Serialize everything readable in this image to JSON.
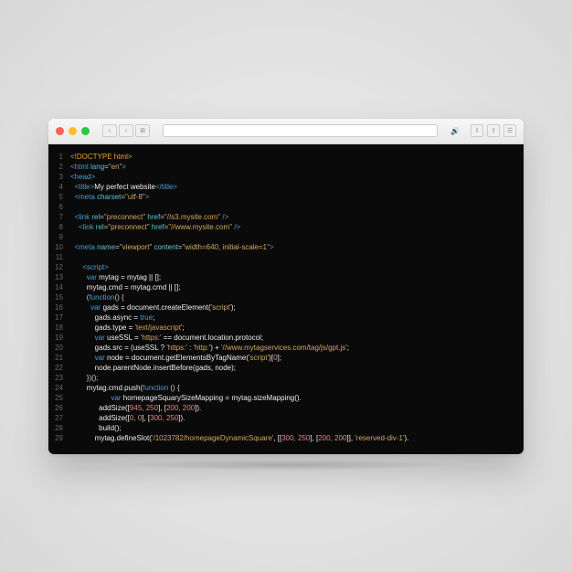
{
  "chrome": {
    "back": "‹",
    "fwd": "›",
    "tabs": "⊞",
    "sound": "🔊",
    "dl": "⇩",
    "share": "⇪",
    "menu": "☰"
  },
  "lines": [
    {
      "n": "1",
      "segs": [
        {
          "c": "code",
          "t": "<!DOCTYPE html>"
        }
      ],
      "ind": 0
    },
    {
      "n": "2",
      "segs": [
        {
          "c": "tag",
          "t": "<html "
        },
        {
          "c": "attr",
          "t": "lang"
        },
        {
          "c": "punc",
          "t": "="
        },
        {
          "c": "str",
          "t": "\"en\""
        },
        {
          "c": "tag",
          "t": ">"
        }
      ],
      "ind": 0
    },
    {
      "n": "3",
      "segs": [
        {
          "c": "tag",
          "t": "<head>"
        }
      ],
      "ind": 0
    },
    {
      "n": "4",
      "segs": [
        {
          "c": "tag",
          "t": "<title>"
        },
        {
          "c": "var",
          "t": "My perfect website"
        },
        {
          "c": "tag",
          "t": "</title>"
        }
      ],
      "ind": 2
    },
    {
      "n": "5",
      "segs": [
        {
          "c": "tag",
          "t": "<meta "
        },
        {
          "c": "attr",
          "t": "charset"
        },
        {
          "c": "punc",
          "t": "="
        },
        {
          "c": "str",
          "t": "\"utf-8\""
        },
        {
          "c": "tag",
          "t": ">"
        }
      ],
      "ind": 2
    },
    {
      "n": "6",
      "segs": [],
      "ind": 0
    },
    {
      "n": "7",
      "segs": [
        {
          "c": "tag",
          "t": "<link "
        },
        {
          "c": "attr",
          "t": "rel"
        },
        {
          "c": "punc",
          "t": "="
        },
        {
          "c": "str",
          "t": "\"preconnect\""
        },
        {
          "c": "attr",
          "t": " href"
        },
        {
          "c": "punc",
          "t": "="
        },
        {
          "c": "str",
          "t": "\"//s3.mysite.com\""
        },
        {
          "c": "tag",
          "t": " />"
        }
      ],
      "ind": 2
    },
    {
      "n": "8",
      "segs": [
        {
          "c": "tag",
          "t": "<link "
        },
        {
          "c": "attr",
          "t": "rel"
        },
        {
          "c": "punc",
          "t": "="
        },
        {
          "c": "str",
          "t": "\"preconnect\""
        },
        {
          "c": "attr",
          "t": " href"
        },
        {
          "c": "punc",
          "t": "="
        },
        {
          "c": "str",
          "t": "\"//www.mysite.com\""
        },
        {
          "c": "tag",
          "t": " />"
        }
      ],
      "ind": 4
    },
    {
      "n": "9",
      "segs": [],
      "ind": 0
    },
    {
      "n": "10",
      "segs": [
        {
          "c": "tag",
          "t": "<meta "
        },
        {
          "c": "attr",
          "t": "name"
        },
        {
          "c": "punc",
          "t": "="
        },
        {
          "c": "str",
          "t": "\"viewport\""
        },
        {
          "c": "attr",
          "t": " content"
        },
        {
          "c": "punc",
          "t": "="
        },
        {
          "c": "str",
          "t": "\"width=640, initial-scale=1\""
        },
        {
          "c": "tag",
          "t": ">"
        }
      ],
      "ind": 2
    },
    {
      "n": "11",
      "segs": [],
      "ind": 0
    },
    {
      "n": "12",
      "segs": [
        {
          "c": "tag",
          "t": "<script>"
        }
      ],
      "ind": 6
    },
    {
      "n": "13",
      "segs": [
        {
          "c": "kw",
          "t": "var "
        },
        {
          "c": "var",
          "t": "mytag = mytag || [];"
        }
      ],
      "ind": 8
    },
    {
      "n": "14",
      "segs": [
        {
          "c": "var",
          "t": "mytag.cmd = mytag.cmd || [];"
        }
      ],
      "ind": 8
    },
    {
      "n": "15",
      "segs": [
        {
          "c": "punc",
          "t": "("
        },
        {
          "c": "kw",
          "t": "function"
        },
        {
          "c": "punc",
          "t": "() {"
        }
      ],
      "ind": 8
    },
    {
      "n": "16",
      "segs": [
        {
          "c": "kw",
          "t": "var "
        },
        {
          "c": "var",
          "t": "gads = document.createElement("
        },
        {
          "c": "str",
          "t": "'script'"
        },
        {
          "c": "var",
          "t": ");"
        }
      ],
      "ind": 10
    },
    {
      "n": "17",
      "segs": [
        {
          "c": "var",
          "t": "gads.async = "
        },
        {
          "c": "kw",
          "t": "true"
        },
        {
          "c": "var",
          "t": ";"
        }
      ],
      "ind": 12
    },
    {
      "n": "18",
      "segs": [
        {
          "c": "var",
          "t": "gads.type = "
        },
        {
          "c": "str",
          "t": "'text/javascript'"
        },
        {
          "c": "var",
          "t": ";"
        }
      ],
      "ind": 12
    },
    {
      "n": "19",
      "segs": [
        {
          "c": "kw",
          "t": "var "
        },
        {
          "c": "var",
          "t": "useSSL = "
        },
        {
          "c": "str",
          "t": "'https:'"
        },
        {
          "c": "var",
          "t": " == document.location.protocol;"
        }
      ],
      "ind": 12
    },
    {
      "n": "20",
      "segs": [
        {
          "c": "var",
          "t": "gads.src = (useSSL ? "
        },
        {
          "c": "str",
          "t": "'https:'"
        },
        {
          "c": "var",
          "t": " : "
        },
        {
          "c": "str",
          "t": "'http:'"
        },
        {
          "c": "var",
          "t": ") + "
        },
        {
          "c": "str",
          "t": "'//www.mytagservices.com/tag/js/gpt.js'"
        },
        {
          "c": "var",
          "t": ";"
        }
      ],
      "ind": 12
    },
    {
      "n": "21",
      "segs": [
        {
          "c": "kw",
          "t": "var "
        },
        {
          "c": "var",
          "t": "node = document.getElementsByTagName("
        },
        {
          "c": "str",
          "t": "'script'"
        },
        {
          "c": "var",
          "t": ")["
        },
        {
          "c": "num",
          "t": "0"
        },
        {
          "c": "var",
          "t": "];"
        }
      ],
      "ind": 12
    },
    {
      "n": "22",
      "segs": [
        {
          "c": "var",
          "t": "node.parentNode.insertBefore(gads, node);"
        }
      ],
      "ind": 12
    },
    {
      "n": "23",
      "segs": [
        {
          "c": "punc",
          "t": "})();"
        }
      ],
      "ind": 8
    },
    {
      "n": "24",
      "segs": [
        {
          "c": "var",
          "t": "mytag.cmd.push("
        },
        {
          "c": "kw",
          "t": "function"
        },
        {
          "c": "punc",
          "t": " () {"
        }
      ],
      "ind": 8
    },
    {
      "n": "25",
      "segs": [
        {
          "c": "kw",
          "t": "var "
        },
        {
          "c": "var",
          "t": "homepageSquarySizeMapping = mytag.sizeMapping()."
        }
      ],
      "ind": 20
    },
    {
      "n": "26",
      "segs": [
        {
          "c": "var",
          "t": "addSize(["
        },
        {
          "c": "num",
          "t": "945, 250"
        },
        {
          "c": "var",
          "t": "], ["
        },
        {
          "c": "num",
          "t": "200, 200"
        },
        {
          "c": "var",
          "t": "])."
        }
      ],
      "ind": 14
    },
    {
      "n": "27",
      "segs": [
        {
          "c": "var",
          "t": "addSize(["
        },
        {
          "c": "num",
          "t": "0, 0"
        },
        {
          "c": "var",
          "t": "], ["
        },
        {
          "c": "num",
          "t": "300, 250"
        },
        {
          "c": "var",
          "t": "])."
        }
      ],
      "ind": 14
    },
    {
      "n": "28",
      "segs": [
        {
          "c": "var",
          "t": "build();"
        }
      ],
      "ind": 14
    },
    {
      "n": "29",
      "segs": [
        {
          "c": "var",
          "t": "mytag.defineSlot("
        },
        {
          "c": "str",
          "t": "'/1023782/homepageDynamicSquare'"
        },
        {
          "c": "var",
          "t": ", [["
        },
        {
          "c": "num",
          "t": "300, 250"
        },
        {
          "c": "var",
          "t": "], ["
        },
        {
          "c": "num",
          "t": "200, 200"
        },
        {
          "c": "var",
          "t": "]], "
        },
        {
          "c": "str",
          "t": "'reserved-div-1'"
        },
        {
          "c": "var",
          "t": ")."
        }
      ],
      "ind": 12
    }
  ]
}
